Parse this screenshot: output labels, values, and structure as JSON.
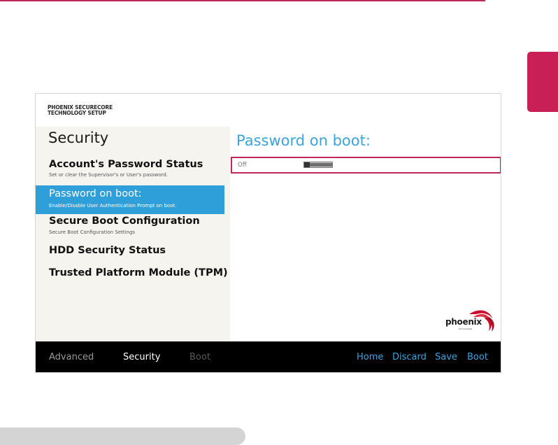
{
  "brand": {
    "line1": "PHOENIX SECURECORE",
    "line2": "TECHNOLOGY SETUP"
  },
  "sidebar": {
    "section_title": "Security",
    "items": [
      {
        "label": "Account's Password Status",
        "desc": "Set or clear the Supervisor's or User's password."
      },
      {
        "label": "Password on boot:",
        "desc": "Enable/Disable User Authentication Prompt on boot."
      },
      {
        "label": "Secure Boot Configuration",
        "desc": "Secure Boot Configuration Settings"
      },
      {
        "label": "HDD Security Status",
        "desc": ""
      },
      {
        "label": "Trusted Platform Module (TPM)",
        "desc": ""
      }
    ],
    "selected_index": 1
  },
  "main": {
    "title": "Password on boot:",
    "option": {
      "value": "Off",
      "toggle_state": "off"
    }
  },
  "logo": {
    "text": "phoenix",
    "sub": "technologies"
  },
  "footer": {
    "tabs": [
      "Advanced",
      "Security",
      "Boot"
    ],
    "active_tab": "Security",
    "actions": [
      "Home",
      "Discard",
      "Save",
      "Boot"
    ]
  },
  "colors": {
    "accent_magenta": "#c91f57",
    "selection_blue": "#2f9fd9",
    "title_blue": "#3ba4dc",
    "bar_black": "#000000"
  }
}
